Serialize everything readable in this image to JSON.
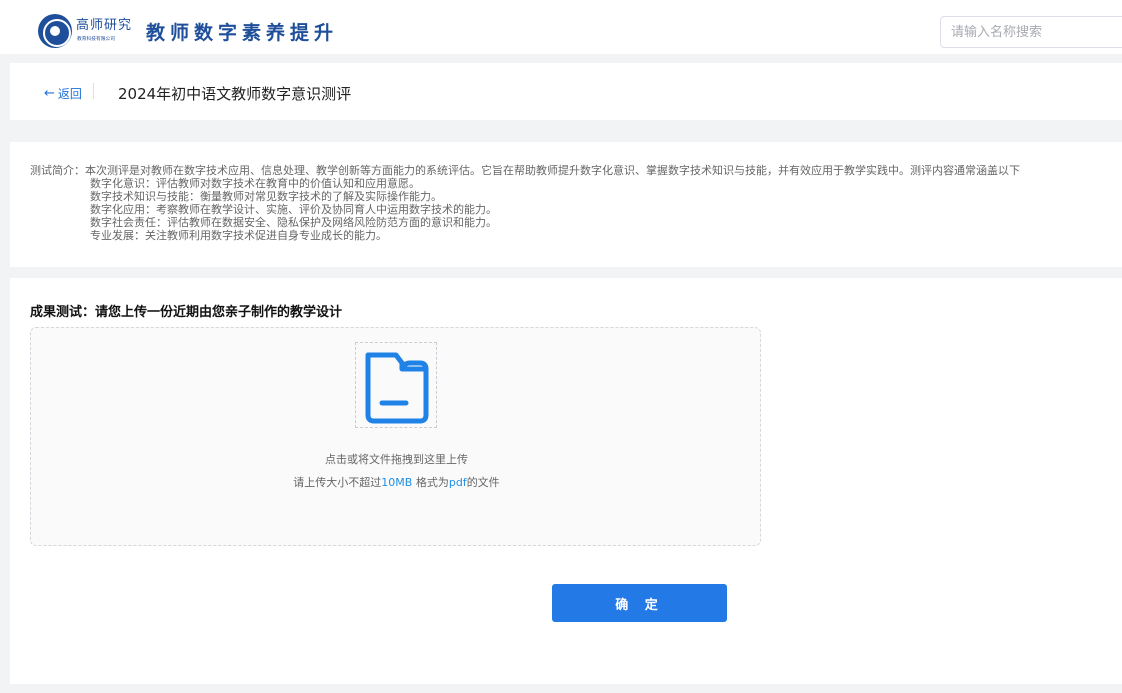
{
  "header": {
    "logo_text": "高师研究",
    "logo_sub": "教育科技有限公司",
    "site_title": "教师数字素养提升",
    "search_placeholder": "请输入名称搜索"
  },
  "title_bar": {
    "back_label": "返回",
    "page_title": "2024年初中语文教师数字意识测评"
  },
  "intro": {
    "lines": [
      "测试简介：本次测评是对教师在数字技术应用、信息处理、教学创新等方面能力的系统评估。它旨在帮助教师提升数字化意识、掌握数字技术知识与技能，并有效应用于教学实践中。测评内容通常涵盖以下",
      "数字化意识：评估教师对数字技术在教育中的价值认知和应用意愿。",
      "数字技术知识与技能：衡量教师对常见数字技术的了解及实际操作能力。",
      "数字化应用：考察教师在教学设计、实施、评价及协同育人中运用数字技术的能力。",
      "数字社会责任：评估教师在数据安全、隐私保护及网络风险防范方面的意识和能力。",
      "专业发展：关注教师利用数字技术促进自身专业成长的能力。"
    ]
  },
  "upload": {
    "section_title": "成果测试：请您上传一份近期由您亲子制作的教学设计",
    "hint": "点击或将文件拖拽到这里上传",
    "limit_prefix": "请上传大小不超过",
    "limit_size": "10MB",
    "limit_mid": " 格式为",
    "limit_format": "pdf",
    "limit_suffix": "的文件",
    "icon": "folder-icon",
    "confirm_label": "确 定"
  },
  "colors": {
    "brand": "#1f4f9a",
    "accent": "#2379e6",
    "link": "#1f70d8"
  }
}
